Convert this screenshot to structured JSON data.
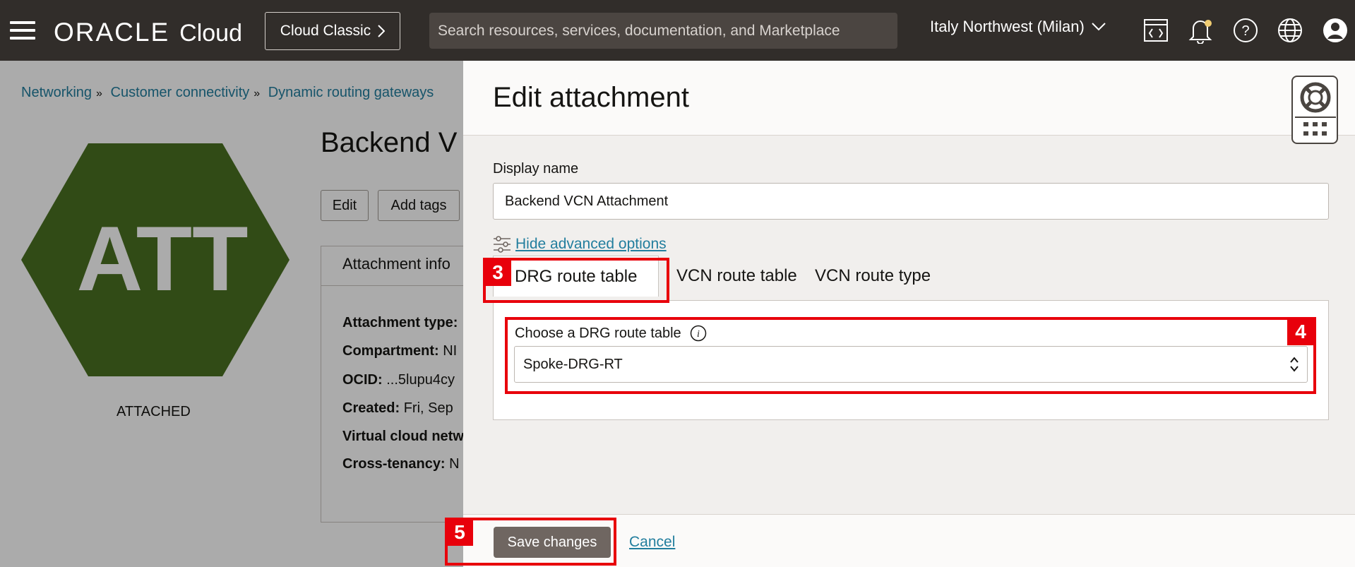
{
  "header": {
    "brand_oracle": "ORACLE",
    "brand_cloud": "Cloud",
    "classic_button": "Cloud Classic",
    "search_placeholder": "Search resources, services, documentation, and Marketplace",
    "region": "Italy Northwest (Milan)",
    "icons": [
      "code-editor-icon",
      "notifications-bell-icon",
      "help-icon",
      "language-globe-icon",
      "user-profile-icon"
    ]
  },
  "background_page": {
    "breadcrumb": [
      "Networking",
      "Customer connectivity",
      "Dynamic routing gateways"
    ],
    "hex_label": "ATT",
    "status": "ATTACHED",
    "title": "Backend V",
    "buttons": {
      "edit": "Edit",
      "add_tags": "Add tags"
    },
    "info_tab": "Attachment info",
    "info_rows": [
      {
        "key": "Attachment type:",
        "value": ""
      },
      {
        "key": "Compartment:",
        "value": "NI"
      },
      {
        "key": "OCID:",
        "value": "...5lupu4cy"
      },
      {
        "key": "Created:",
        "value": "Fri, Sep"
      },
      {
        "key": "Virtual cloud netw",
        "value": ""
      },
      {
        "key": "Cross-tenancy:",
        "value": "N"
      }
    ],
    "hex_color": "#4a7021"
  },
  "panel": {
    "title": "Edit attachment",
    "display_name_label": "Display name",
    "display_name_value": "Backend VCN Attachment",
    "advanced_link": "Hide advanced options",
    "tabs": [
      "DRG route table",
      "VCN route table",
      "VCN route type"
    ],
    "active_tab": "DRG route table",
    "drg_select_label": "Choose a DRG route table",
    "drg_select_value": "Spoke-DRG-RT",
    "save_button": "Save changes",
    "cancel_link": "Cancel"
  },
  "annotations": [
    {
      "badge": "3",
      "target": "DRG route table tab"
    },
    {
      "badge": "4",
      "target": "Choose a DRG route table"
    },
    {
      "badge": "5",
      "target": "Save changes"
    }
  ],
  "colors": {
    "topbar": "#312d2a",
    "link": "#227e9e",
    "annotation_red": "#e8000b",
    "primary_button": "#6f6661"
  }
}
